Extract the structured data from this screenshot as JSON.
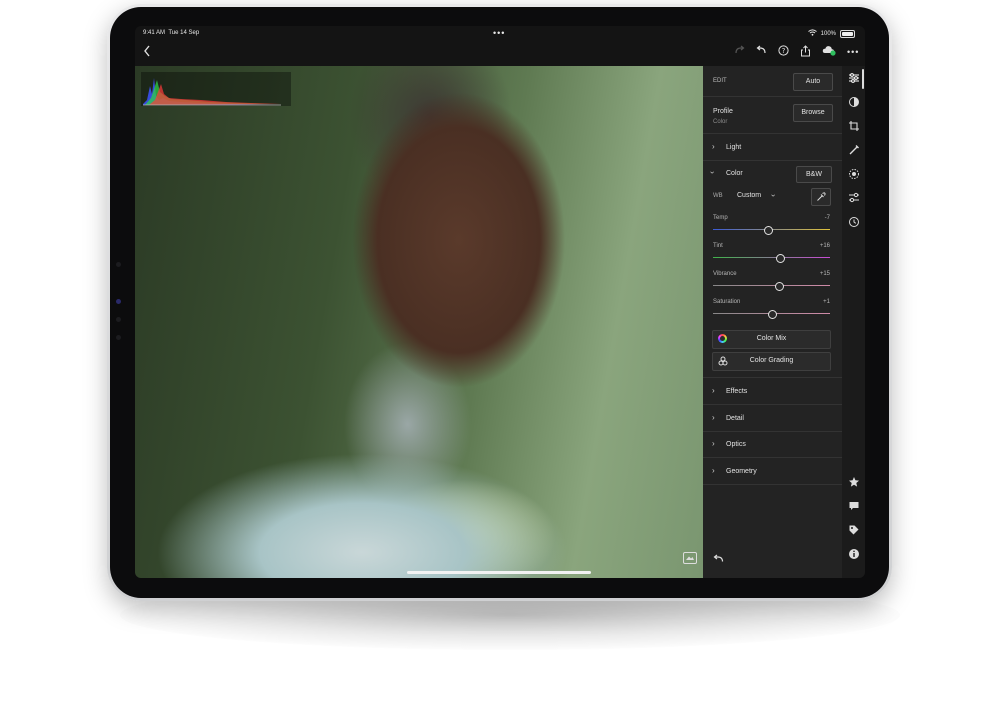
{
  "status": {
    "time": "9:41 AM",
    "date": "Tue 14 Sep",
    "battery": "100%"
  },
  "toolbar": {
    "back_icon": "chevron-left-icon",
    "more_dots": "•••"
  },
  "panel": {
    "edit_label": "EDIT",
    "auto_label": "Auto",
    "profile_label": "Profile",
    "profile_value": "Color",
    "browse_label": "Browse",
    "light_label": "Light",
    "color_label": "Color",
    "bw_label": "B&W",
    "wb_label": "WB",
    "wb_value": "Custom",
    "sliders": [
      {
        "label": "Temp",
        "value": "-7",
        "level": 0.47
      },
      {
        "label": "Tint",
        "value": "+16",
        "level": 0.57
      },
      {
        "label": "Vibrance",
        "value": "+15",
        "level": 0.565
      },
      {
        "label": "Saturation",
        "value": "+1",
        "level": 0.505
      }
    ],
    "color_mix_label": "Color Mix",
    "color_grading_label": "Color Grading",
    "sections": [
      "Effects",
      "Detail",
      "Optics",
      "Geometry"
    ]
  },
  "colors": {
    "temp": [
      "#3b5bd6",
      "#e0c23a"
    ],
    "tint": [
      "#3fb34a",
      "#c94bd6"
    ],
    "vibrance": [
      "#888888",
      "#d08aa8"
    ],
    "saturation": [
      "#888888",
      "#d08aa8"
    ]
  }
}
